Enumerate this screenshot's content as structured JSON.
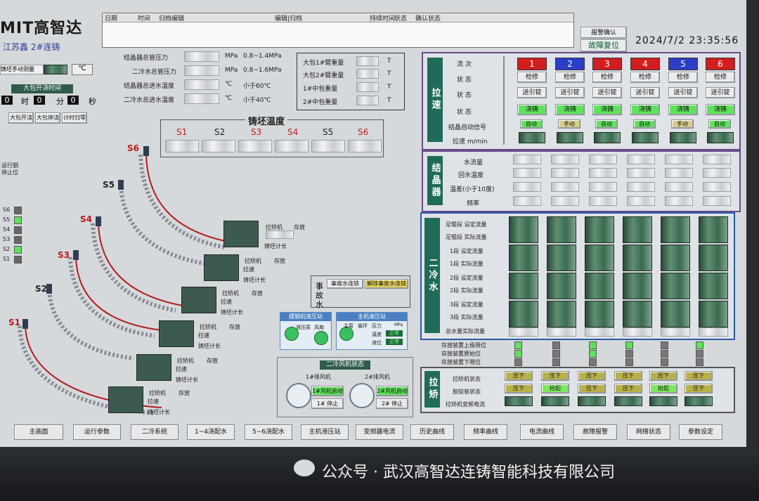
{
  "header": {
    "logo": "MIT高智达",
    "site_name": "江苏鑫  2#连铸",
    "datetime": "2024/7/2  23:35:56",
    "alarm_confirm": "报警确认",
    "fault_reset": "故障复位",
    "log_columns": [
      "日期",
      "时间",
      "归档编辑",
      "编辑|归档",
      "持续时间",
      "状态",
      "确认状态"
    ]
  },
  "left": {
    "mode_label": "铸坯手动测量",
    "temp_unit": "℃",
    "ladle_timer_title": "大包开浇时间",
    "timer": {
      "h": "0",
      "h_unit": "时",
      "m": "0",
      "m_unit": "分",
      "s": "0",
      "s_unit": "秒"
    },
    "buttons": [
      "大包开浇",
      "大包停浇",
      "计时归零"
    ],
    "side_notes": [
      "运行钢",
      "停止位"
    ],
    "strands": [
      "S6",
      "S5",
      "S4",
      "S3",
      "S2",
      "S1"
    ]
  },
  "pressure": {
    "rows": [
      {
        "label": "结晶器总管压力",
        "unit": "MPa",
        "range": "0.8~1.4MPa"
      },
      {
        "label": "二冷水总管压力",
        "unit": "MPa",
        "range": "0.8~1.6MPa"
      },
      {
        "label": "结晶器总进水温度",
        "unit": "℃",
        "range": "小于60℃"
      },
      {
        "label": "二冷水总进水温度",
        "unit": "℃",
        "range": "小于40℃"
      }
    ]
  },
  "ladle": {
    "rows": [
      {
        "label": "大包1#臂重量",
        "unit": "T"
      },
      {
        "label": "大包2#臂重量",
        "unit": "T"
      },
      {
        "label": "1#中包重量",
        "unit": "T"
      },
      {
        "label": "2#中包重量",
        "unit": "T"
      }
    ]
  },
  "billet_temp": {
    "title": "铸坯温度",
    "labels": [
      "S1",
      "S2",
      "S3",
      "S4",
      "S5",
      "S6"
    ]
  },
  "strand_machine": {
    "labels": [
      "拉矫机",
      "存放"
    ],
    "speed": "拉速",
    "length": "铸坯计长"
  },
  "emergency": {
    "title": "事故水",
    "btn1": "事故水连锁",
    "btn2": "解除事故水连锁"
  },
  "hydraulics": {
    "left_title": "摆钢机液压站",
    "left_labels": [
      "液压泵",
      "风扇"
    ],
    "right_title": "主机液压站",
    "right_labels": [
      "主泵",
      "循环",
      "压力",
      "温度",
      "液位"
    ],
    "pressure_unit": "MPa",
    "status_normal": "正常"
  },
  "fans": {
    "title": "二冷风机状态",
    "fan1": "1#排风机",
    "fan2": "2#排风机",
    "start1": "1#风机启动",
    "stop1": "1# 停止",
    "start2": "2#风机启动",
    "stop2": "2# 停止"
  },
  "speed_panel": {
    "title": "拉速",
    "rows": [
      "流  次",
      "状  态",
      "状  态",
      "状  态",
      "结晶自动信号",
      "拉速 m/min"
    ],
    "strand_numbers": [
      "1",
      "2",
      "3",
      "4",
      "5",
      "6"
    ],
    "row1": "检修",
    "row2": "送引锭",
    "row3": "浇铸",
    "auto": "自动",
    "manual": "手动"
  },
  "mold_panel": {
    "title": "结晶器",
    "rows": [
      "水流量",
      "回水温度",
      "温差(小于10度)",
      "频率"
    ]
  },
  "cooling_panel": {
    "title": "二冷水",
    "rows": [
      "足辊段 设定流量",
      "足辊段 实际流量",
      "1段  设定流量",
      "1段  实际流量",
      "2段  设定流量",
      "2段  实际流量",
      "3段  设定流量",
      "3段  实际流量",
      "总水量实际流量"
    ]
  },
  "storage": {
    "rows": [
      "存放装置上极限位",
      "存放装置原始位",
      "存放装置下限位"
    ]
  },
  "straightener": {
    "title": "拉矫",
    "rows": [
      "拉矫机状态",
      "脱锭装状态",
      "拉矫机变频电流"
    ],
    "press": "压下",
    "lift": "抬起"
  },
  "nav": [
    "主画面",
    "运行参数",
    "二冷系统",
    "1~4浇配水",
    "5~6浇配水",
    "主机液压站",
    "变频器电流",
    "历史曲线",
    "频率曲线",
    "电流曲线",
    "故障报警",
    "网络状态",
    "参数设定"
  ],
  "watermark": "公众号 · 武汉高智达连铸智能科技有限公司"
}
